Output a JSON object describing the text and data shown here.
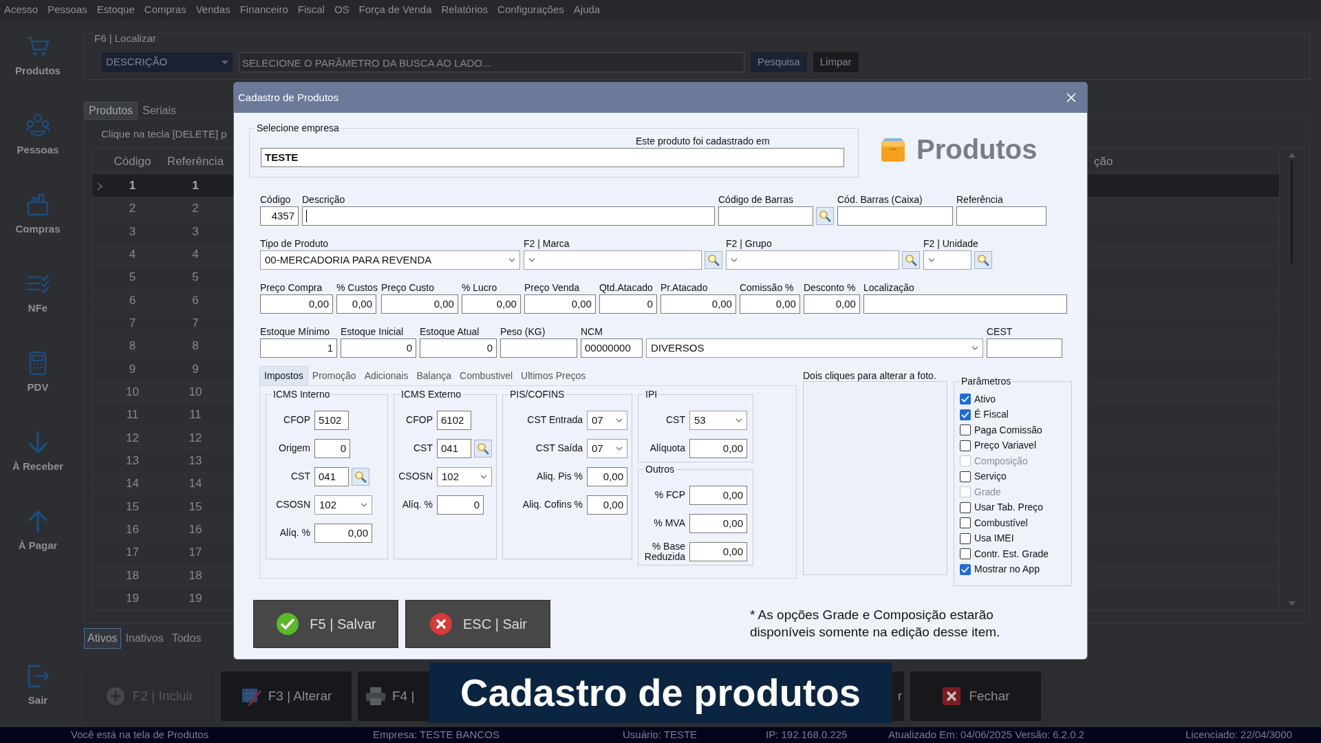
{
  "menu": [
    "Acesso",
    "Pessoas",
    "Estoque",
    "Compras",
    "Vendas",
    "Financeiro",
    "Fiscal",
    "OS",
    "Força de Venda",
    "Relatórios",
    "Configurações",
    "Ajuda"
  ],
  "sidebar": [
    {
      "label": "Produtos",
      "kind": "cart"
    },
    {
      "label": "Pessoas",
      "kind": "people"
    },
    {
      "label": "Compras",
      "kind": "bag"
    },
    {
      "label": "NFe",
      "kind": "checklist"
    },
    {
      "label": "PDV",
      "kind": "terminal"
    },
    {
      "label": "À Receber",
      "kind": "down"
    },
    {
      "label": "À Pagar",
      "kind": "up"
    },
    {
      "label": "Sair",
      "kind": "exit"
    }
  ],
  "search": {
    "legend": "F6 | Localizar",
    "parameter": "DESCRIÇÃO",
    "placeholder": "SELECIONE O PARÂMETRO DA BUSCA AO LADO...",
    "buttons": [
      "Pesquisa",
      "Limpar"
    ]
  },
  "list_tabs": [
    {
      "label": "Produtos",
      "selected": true
    },
    {
      "label": "Seriais",
      "selected": false
    }
  ],
  "hint": "Clique na tecla [DELETE] p",
  "table": {
    "columns": [
      "Código",
      "Referência",
      "ção"
    ],
    "rows": [
      {
        "codigo": "1",
        "referencia": "1",
        "selected": true
      },
      {
        "codigo": "2",
        "referencia": "2",
        "selected": false
      },
      {
        "codigo": "3",
        "referencia": "3",
        "selected": false
      },
      {
        "codigo": "4",
        "referencia": "4",
        "selected": false
      },
      {
        "codigo": "5",
        "referencia": "5",
        "selected": false
      },
      {
        "codigo": "6",
        "referencia": "6",
        "selected": false
      },
      {
        "codigo": "7",
        "referencia": "7",
        "selected": false
      },
      {
        "codigo": "8",
        "referencia": "8",
        "selected": false
      },
      {
        "codigo": "9",
        "referencia": "9",
        "selected": false
      },
      {
        "codigo": "10",
        "referencia": "10",
        "selected": false
      },
      {
        "codigo": "11",
        "referencia": "11",
        "selected": false
      },
      {
        "codigo": "12",
        "referencia": "12",
        "selected": false
      },
      {
        "codigo": "13",
        "referencia": "13",
        "selected": false
      },
      {
        "codigo": "14",
        "referencia": "14",
        "selected": false
      },
      {
        "codigo": "15",
        "referencia": "15",
        "selected": false
      },
      {
        "codigo": "16",
        "referencia": "16",
        "selected": false
      },
      {
        "codigo": "17",
        "referencia": "17",
        "selected": false
      },
      {
        "codigo": "18",
        "referencia": "18",
        "selected": false
      },
      {
        "codigo": "19",
        "referencia": "19",
        "selected": false
      }
    ]
  },
  "filter_tabs": [
    {
      "label": "Ativos",
      "selected": true
    },
    {
      "label": "Inativos",
      "selected": false
    },
    {
      "label": "Todos",
      "selected": false
    }
  ],
  "actions": [
    {
      "label": "F2 | Incluir",
      "kind": "add",
      "disabled": true
    },
    {
      "label": "F3 | Alterar",
      "kind": "edit",
      "disabled": false
    },
    {
      "label": "F4 |",
      "kind": "print",
      "disabled": false
    },
    {
      "label": "r",
      "kind": "plain",
      "disabled": false
    },
    {
      "label": "Fechar",
      "kind": "close",
      "disabled": false
    }
  ],
  "status_bar": [
    "Você está na tela de Produtos",
    "Empresa: TESTE BANCOS",
    "Usuário: TESTE",
    "IP: 192.168.0.225",
    "Atualizado Em: 04/06/2025  Versão: 6.2.0.2",
    "Licenciado: 22/04/3000"
  ],
  "dialog": {
    "title": "Cadastro de Produtos",
    "company": {
      "legend": "Selecione empresa",
      "note": "Este produto foi cadastrado em",
      "value": "TESTE"
    },
    "brand": "Produtos",
    "field_rows": [
      [
        {
          "label": "Código",
          "value": "4357",
          "kind": "number"
        },
        {
          "label": "Descrição",
          "kind": "text",
          "focused": true
        },
        {
          "label": "Código de Barras",
          "kind": "text",
          "lookup": true
        },
        {
          "label": "Cód. Barras (Caixa)",
          "kind": "text"
        },
        {
          "label": "Referência",
          "kind": "text"
        }
      ],
      [
        {
          "label": "Tipo de Produto",
          "value": "00-MERCADORIA PARA REVENDA",
          "kind": "select"
        },
        {
          "label": "F2 | Marca",
          "kind": "select",
          "lookup": true
        },
        {
          "label": "F2 | Grupo",
          "kind": "select",
          "lookup": true
        },
        {
          "label": "F2 | Unidade",
          "kind": "select",
          "lookup": true
        }
      ],
      [
        {
          "label": "Preço Compra",
          "value": "0,00",
          "kind": "number"
        },
        {
          "label": "% Custos",
          "value": "0,00",
          "kind": "number"
        },
        {
          "label": "Preço Custo",
          "value": "0,00",
          "kind": "number"
        },
        {
          "label": "% Lucro",
          "value": "0,00",
          "kind": "number"
        },
        {
          "label": "Preço Venda",
          "value": "0,00",
          "kind": "number"
        },
        {
          "label": "Qtd.Atacado",
          "value": "0",
          "kind": "number"
        },
        {
          "label": "Pr.Atacado",
          "value": "0,00",
          "kind": "number"
        },
        {
          "label": "Comissão %",
          "value": "0,00",
          "kind": "number"
        },
        {
          "label": "Desconto %",
          "value": "0,00",
          "kind": "number"
        },
        {
          "label": "Localização",
          "kind": "text"
        }
      ],
      [
        {
          "label": "Estoque Mínimo",
          "value": "1",
          "kind": "number"
        },
        {
          "label": "Estoque Inicial",
          "value": "0",
          "kind": "number"
        },
        {
          "label": "Estoque Atual",
          "value": "0",
          "kind": "number"
        },
        {
          "label": "Peso (KG)",
          "kind": "number"
        },
        {
          "label": "NCM",
          "value": "00000000",
          "kind": "text"
        },
        {
          "value": "DIVERSOS",
          "kind": "select"
        },
        {
          "label": "CEST",
          "kind": "text"
        }
      ]
    ],
    "tabs": [
      {
        "label": "Impostos",
        "selected": true
      },
      {
        "label": "Promoção",
        "selected": false
      },
      {
        "label": "Adicionais",
        "selected": false
      },
      {
        "label": "Balança",
        "selected": false
      },
      {
        "label": "Combustivel",
        "selected": false
      },
      {
        "label": "Ultimos Preços",
        "selected": false
      }
    ],
    "tax_groups": [
      {
        "title": "ICMS Interno",
        "rows": [
          {
            "label": "CFOP",
            "value": "5102",
            "kind": "code"
          },
          {
            "label": "Origem",
            "value": "0",
            "kind": "short"
          },
          {
            "label": "CST",
            "value": "041",
            "kind": "code",
            "lookup": true
          },
          {
            "label": "CSOSN",
            "value": "102",
            "kind": "select"
          },
          {
            "label": "Alíq. %",
            "value": "0,00",
            "kind": "number"
          }
        ]
      },
      {
        "title": "ICMS Externo",
        "rows": [
          {
            "label": "CFOP",
            "value": "6102",
            "kind": "code"
          },
          {
            "label": "CST",
            "value": "041",
            "kind": "code",
            "lookup": true
          },
          {
            "label": "CSOSN",
            "value": "102",
            "kind": "select"
          },
          {
            "label": "Alíq. %",
            "value": "0",
            "kind": "number"
          }
        ]
      },
      {
        "title": "PIS/COFINS",
        "rows": [
          {
            "label": "CST Entrada",
            "value": "07",
            "kind": "select"
          },
          {
            "label": "CST Saída",
            "value": "07",
            "kind": "select"
          },
          {
            "label": "Aliq. Pis %",
            "value": "0,00",
            "kind": "number"
          },
          {
            "label": "Aliq. Cofins %",
            "value": "0,00",
            "kind": "number"
          }
        ]
      },
      {
        "title": "IPI",
        "rows": [
          {
            "label": "CST",
            "value": "53",
            "kind": "select"
          },
          {
            "label": "Alíquota",
            "value": "0,00",
            "kind": "number"
          }
        ]
      },
      {
        "title": "Outros",
        "rows": [
          {
            "label": "% FCP",
            "value": "0,00",
            "kind": "number"
          },
          {
            "label": "% MVA",
            "value": "0,00",
            "kind": "number"
          },
          {
            "label": "% Base Reduzida",
            "value": "0,00",
            "kind": "number"
          }
        ]
      }
    ],
    "photo_hint": "Dois cliques para alterar a foto.",
    "parameters_title": "Parâmetros",
    "parameters": [
      {
        "label": "Ativo",
        "checked": true,
        "disabled": false
      },
      {
        "label": "É Fiscal",
        "checked": true,
        "disabled": false
      },
      {
        "label": "Paga Comissão",
        "checked": false,
        "disabled": false
      },
      {
        "label": "Preço Variavel",
        "checked": false,
        "disabled": false
      },
      {
        "label": "Composição",
        "checked": false,
        "disabled": true
      },
      {
        "label": "Serviço",
        "checked": false,
        "disabled": false
      },
      {
        "label": "Grade",
        "checked": false,
        "disabled": true
      },
      {
        "label": "Usar Tab. Preço",
        "checked": false,
        "disabled": false
      },
      {
        "label": "Combustível",
        "checked": false,
        "disabled": false
      },
      {
        "label": "Usa IMEI",
        "checked": false,
        "disabled": false
      },
      {
        "label": "Contr. Est. Grade",
        "checked": false,
        "disabled": false
      },
      {
        "label": "Mostrar no App",
        "checked": true,
        "disabled": false
      }
    ],
    "buttons": [
      {
        "label": "F5 | Salvar",
        "kind": "save"
      },
      {
        "label": "ESC | Sair",
        "kind": "cancel"
      }
    ],
    "note": "* As opções Grade e Composição estarão disponíveis somente na edição desse item."
  },
  "caption": "Cadastro de produtos"
}
